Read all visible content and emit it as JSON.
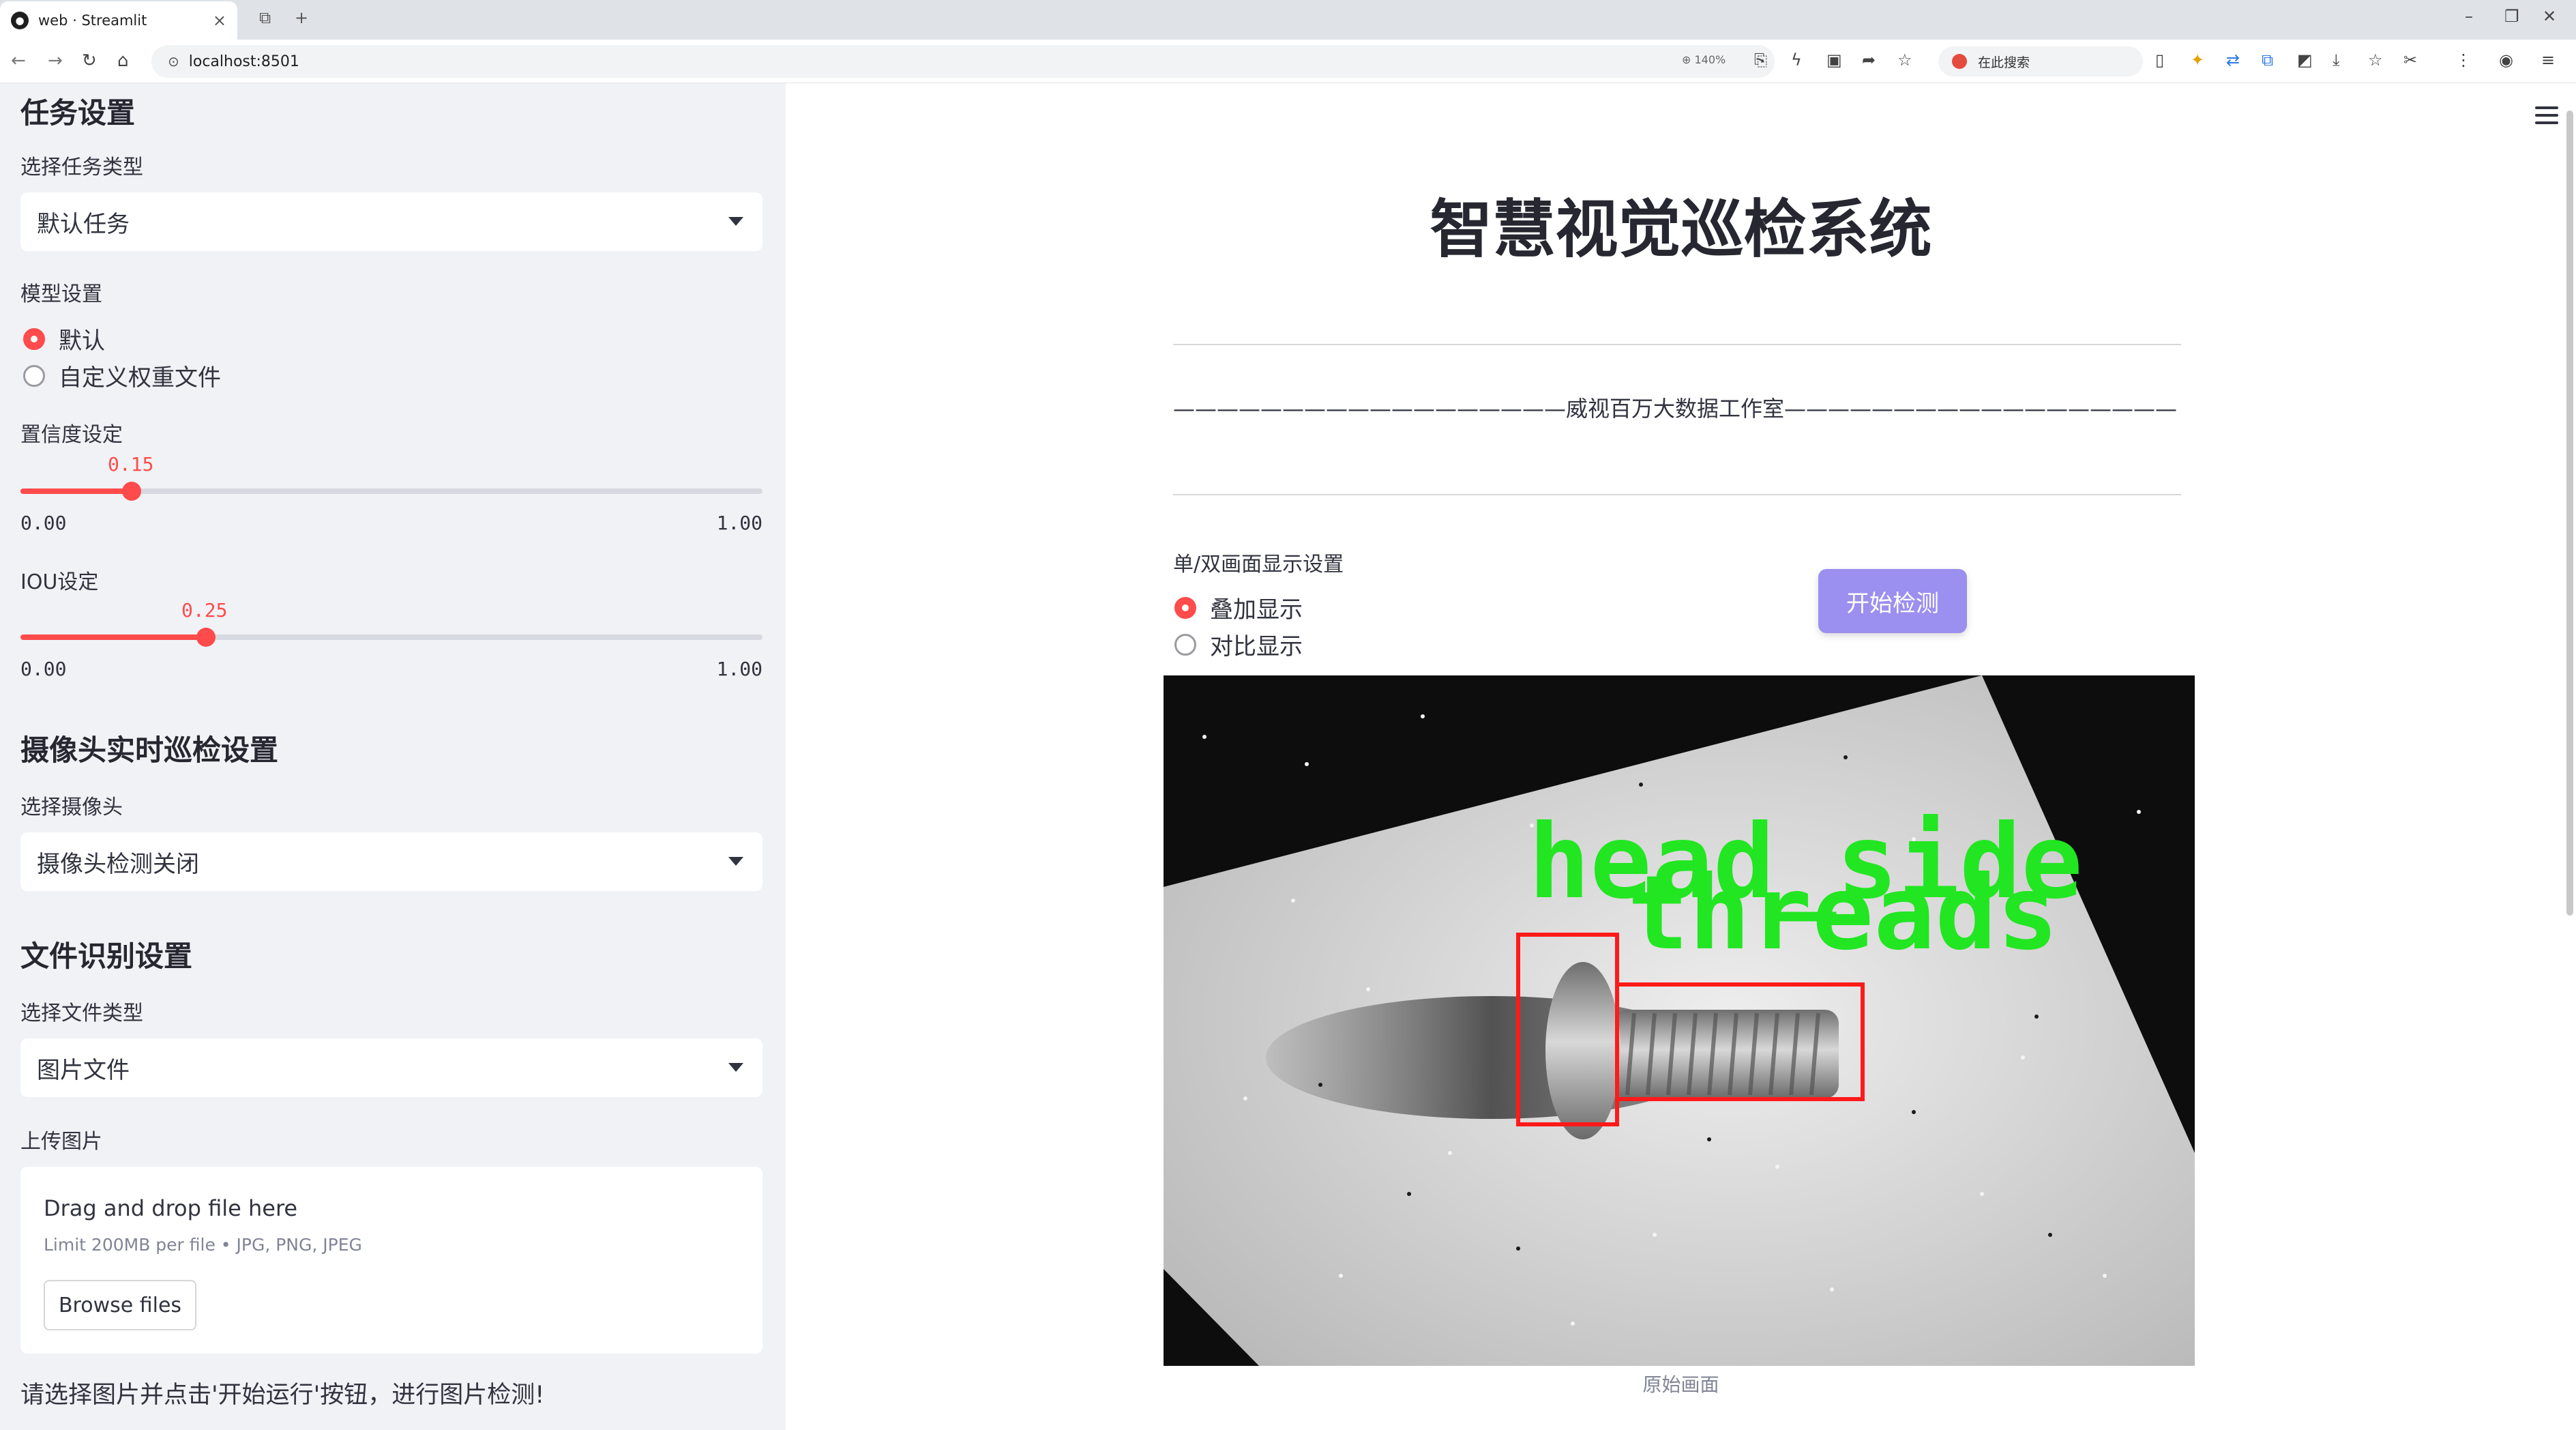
{
  "browser": {
    "tab_title": "web · Streamlit",
    "tab_close": "×",
    "new_tab": "+",
    "url": "localhost:8501",
    "zoom": "140%",
    "search_placeholder": "在此搜索"
  },
  "sidebar": {
    "task_section": "任务设置",
    "task_type_label": "选择任务类型",
    "task_type_value": "默认任务",
    "model_label": "模型设置",
    "model_options": [
      "默认",
      "自定义权重文件"
    ],
    "model_selected": 0,
    "conf_label": "置信度设定",
    "conf_value": "0.15",
    "conf_fraction": 0.15,
    "iou_label": "IOU设定",
    "iou_value": "0.25",
    "iou_fraction": 0.25,
    "slider_min": "0.00",
    "slider_max": "1.00",
    "camera_section": "摄像头实时巡检设置",
    "camera_label": "选择摄像头",
    "camera_value": "摄像头检测关闭",
    "file_section": "文件识别设置",
    "file_type_label": "选择文件类型",
    "file_type_value": "图片文件",
    "upload_label": "上传图片",
    "upload_drag": "Drag and drop file here",
    "upload_limit": "Limit 200MB per file • JPG, PNG, JPEG",
    "browse_button": "Browse files",
    "note": "请选择图片并点击'开始运行'按钮，进行图片检测!"
  },
  "main": {
    "title": "智慧视觉巡检系统",
    "subtitle": "——————————————————威视百万大数据工作室——————————————————",
    "display_label": "单/双画面显示设置",
    "display_options": [
      "叠加显示",
      "对比显示"
    ],
    "display_selected": 0,
    "start_button": "开始检测",
    "detections": [
      "head_side",
      "threads"
    ],
    "caption": "原始画面"
  },
  "colors": {
    "accent": "#ff4b4b",
    "button": "#9b8ff0",
    "sidebar_bg": "#f0f2f6",
    "box": "#ff1a1a",
    "label": "#22e622"
  }
}
